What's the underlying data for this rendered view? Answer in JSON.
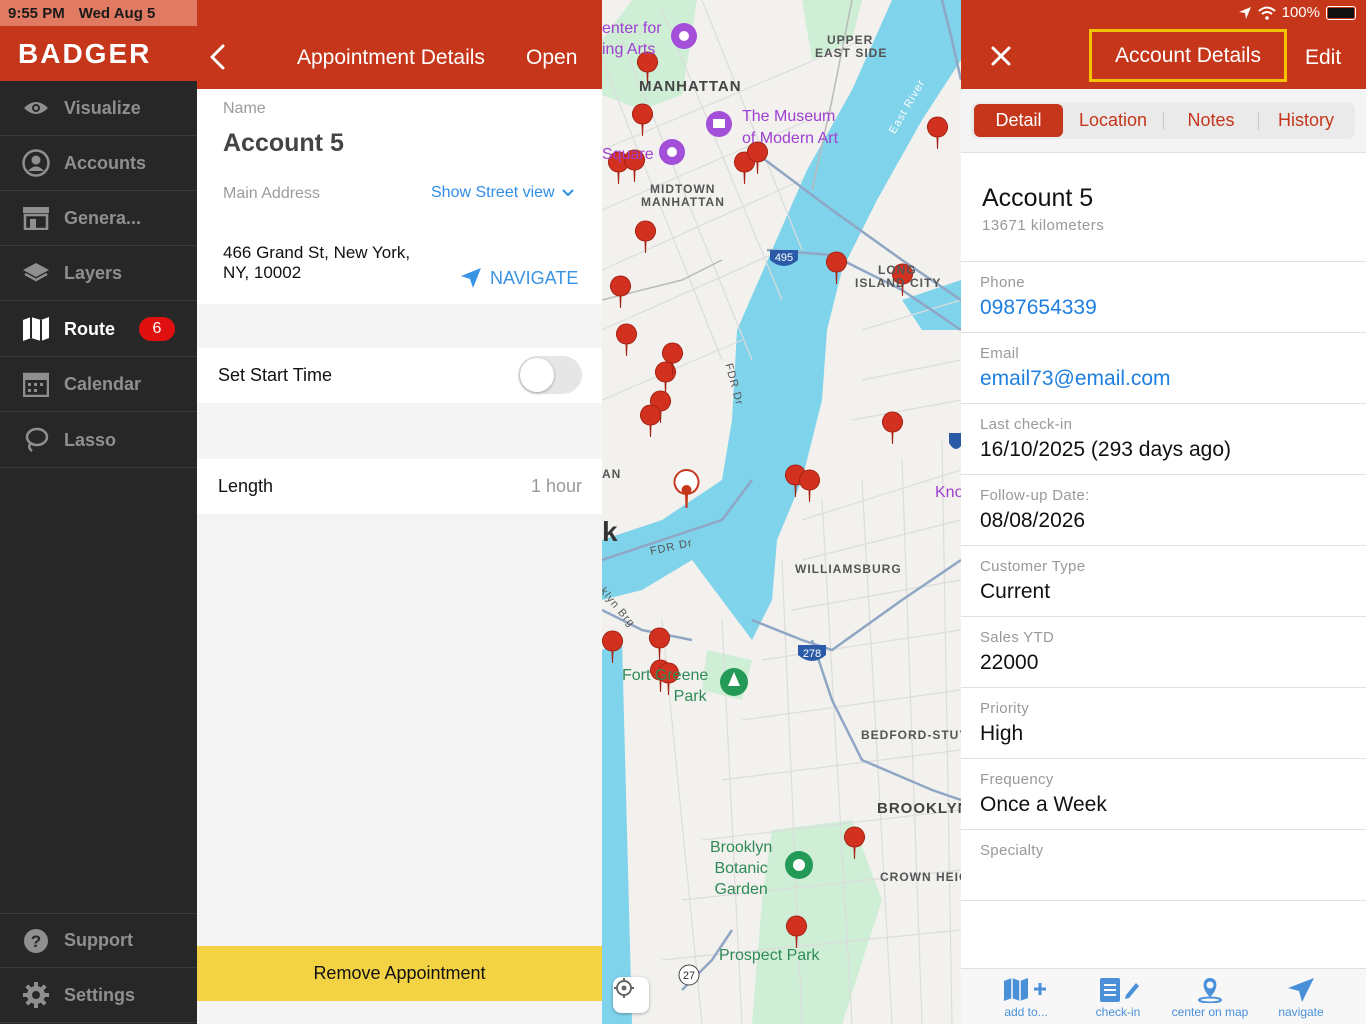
{
  "status": {
    "time": "9:55 PM",
    "date": "Wed Aug 5",
    "battery": "100%"
  },
  "sidebar": {
    "brand": "BADGER",
    "items": [
      {
        "label": "Visualize",
        "icon": "eye-icon"
      },
      {
        "label": "Accounts",
        "icon": "person-icon"
      },
      {
        "label": "Genera...",
        "icon": "store-icon"
      },
      {
        "label": "Layers",
        "icon": "layers-icon"
      },
      {
        "label": "Route",
        "icon": "map-icon",
        "badge": "6",
        "active": true
      },
      {
        "label": "Calendar",
        "icon": "calendar-icon"
      },
      {
        "label": "Lasso",
        "icon": "lasso-icon"
      }
    ],
    "bottom": [
      {
        "label": "Support",
        "icon": "help-icon"
      },
      {
        "label": "Settings",
        "icon": "gear-icon"
      }
    ]
  },
  "appointment": {
    "title": "Appointment Details",
    "open_label": "Open",
    "name_label": "Name",
    "name_value": "Account 5",
    "address_label": "Main Address",
    "street_view_label": "Show Street view",
    "address_value": "466 Grand St, New York, NY, 10002",
    "navigate_label": "NAVIGATE",
    "start_time_label": "Set Start Time",
    "start_time_enabled": false,
    "length_label": "Length",
    "length_value": "1 hour",
    "remove_label": "Remove Appointment"
  },
  "map": {
    "labels": {
      "upper_east_side_1": "UPPER",
      "upper_east_side_2": "EAST SIDE",
      "manhattan": "MANHATTAN",
      "midtown_1": "MIDTOWN",
      "midtown_2": "MANHATTAN",
      "long_island_1": "LONG",
      "long_island_2": "ISLAND CITY",
      "williamsburg": "WILLIAMSBURG",
      "bedford": "BEDFORD-STUY",
      "brooklyn": "BROOKLYN",
      "crown": "CROWN HEIG",
      "an": "AN",
      "k": "k",
      "kno": "Kno",
      "east_river": "East River",
      "fdr1": "FDR Dr",
      "fdr2": "FDR Dr",
      "bklyn_brg": "oklyn Brg"
    },
    "pois": {
      "arts_1": "enter for",
      "arts_2": "ing Arts",
      "moma_1": "The Museum",
      "moma_2": "of Modern Art",
      "square": "Square",
      "fort_greene_1": "Fort Greene",
      "fort_greene_2": "Park",
      "botanic_1": "Brooklyn",
      "botanic_2": "Botanic",
      "botanic_3": "Garden",
      "prospect": "Prospect Park"
    },
    "highways": {
      "i495": "495",
      "i278": "278",
      "r27": "27",
      "i27b": "27"
    }
  },
  "account": {
    "title": "Account Details",
    "edit_label": "Edit",
    "tabs": [
      "Detail",
      "Location",
      "Notes",
      "History"
    ],
    "selected_tab": "Detail",
    "name": "Account 5",
    "distance": "13671 kilometers",
    "fields": [
      {
        "label": "Phone",
        "value": "0987654339",
        "link": true
      },
      {
        "label": "Email",
        "value": "email73@email.com",
        "link": true
      },
      {
        "label": "Last check-in",
        "value": "16/10/2025 (293 days ago)"
      },
      {
        "label": "Follow-up Date:",
        "value": "08/08/2026"
      },
      {
        "label": "Customer Type",
        "value": "Current"
      },
      {
        "label": "Sales YTD",
        "value": "22000"
      },
      {
        "label": "Priority",
        "value": "High"
      },
      {
        "label": "Frequency",
        "value": "Once a Week"
      },
      {
        "label": "Specialty",
        "value": ""
      }
    ],
    "toolbar": [
      {
        "label": "add to...",
        "icon": "map-add-icon"
      },
      {
        "label": "check-in",
        "icon": "checkin-icon"
      },
      {
        "label": "center on map",
        "icon": "pin-icon"
      },
      {
        "label": "navigate",
        "icon": "navigate-icon"
      }
    ]
  },
  "colors": {
    "brand_red": "#c5361b",
    "sidebar_bg": "#272727",
    "remove_yellow": "#f3d244",
    "link_blue": "#1e7fe0",
    "highlight_yellow": "#f3c200",
    "water": "#7fd3ea",
    "park": "#cfeed6"
  }
}
